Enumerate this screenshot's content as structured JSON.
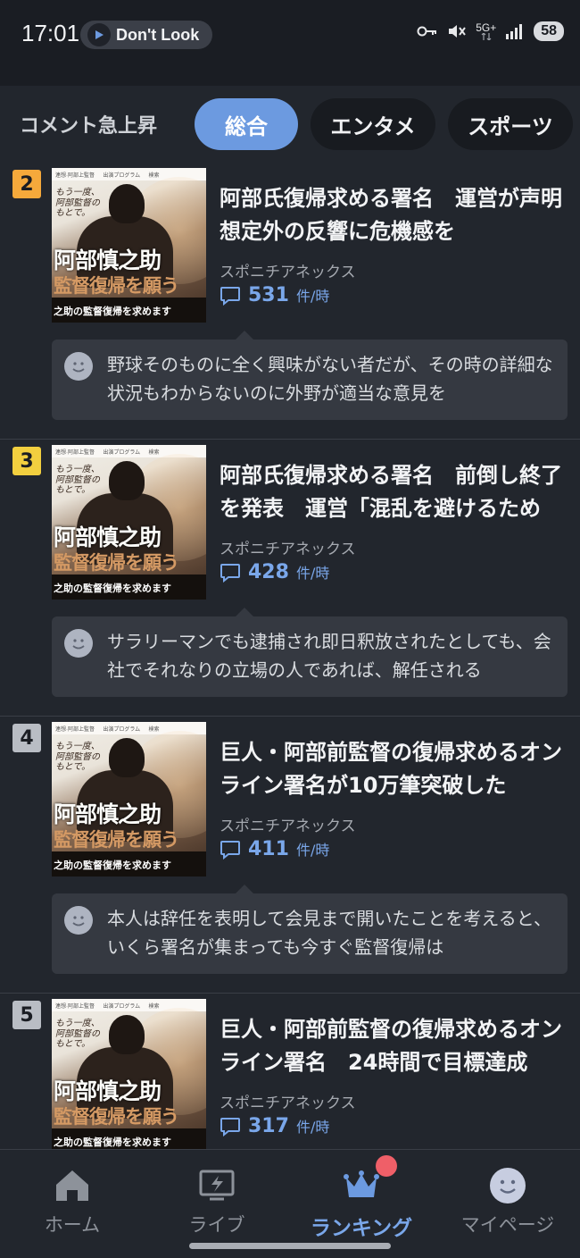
{
  "status_bar": {
    "time": "17:01",
    "notification": "Don't Look",
    "network": "5G+",
    "battery": "58",
    "icons": [
      "key-icon",
      "mute-icon",
      "signal-icon",
      "battery-icon"
    ]
  },
  "tabs_header": {
    "title": "コメント急上昇",
    "tabs": [
      {
        "label": "総合",
        "active": true
      },
      {
        "label": "エンタメ",
        "active": false
      },
      {
        "label": "スポーツ",
        "active": false
      }
    ]
  },
  "thumbnail_text": {
    "top_bar": "連想·阿部上監督 　 出演プログラム 　 検索",
    "pre": "もう一度、\n阿部監督の\nもとで。",
    "name": "阿部慎之助",
    "sub": "監督復帰を願う",
    "caption": "之助の監督復帰を求めます"
  },
  "articles": [
    {
      "rank": "2",
      "rank_color": "#f5a93b",
      "title": "阿部氏復帰求める署名　運営が声明　想定外の反響に危機感を",
      "source": "スポニチアネックス",
      "count": "531",
      "count_unit": "件/時",
      "comment": "野球そのものに全く興味がない者だが、その時の詳細な状況もわからないのに外野が適当な意見を"
    },
    {
      "rank": "3",
      "rank_color": "#f2cf3f",
      "title": "阿部氏復帰求める署名　前倒し終了を発表　運営「混乱を避けるため",
      "source": "スポニチアネックス",
      "count": "428",
      "count_unit": "件/時",
      "comment": "サラリーマンでも逮捕され即日釈放されたとしても、会社でそれなりの立場の人であれば、解任される"
    },
    {
      "rank": "4",
      "rank_color": "#b9bdc4",
      "title": "巨人・阿部前監督の復帰求めるオンライン署名が10万筆突破した",
      "source": "スポニチアネックス",
      "count": "411",
      "count_unit": "件/時",
      "comment": "本人は辞任を表明して会見まで開いたことを考えると、いくら署名が集まっても今すぐ監督復帰は"
    },
    {
      "rank": "5",
      "rank_color": "#b9bdc4",
      "title": "巨人・阿部前監督の復帰求めるオンライン署名　24時間で目標達成",
      "source": "スポニチアネックス",
      "count": "317",
      "count_unit": "件/時",
      "comment": ""
    }
  ],
  "bottom_nav": {
    "items": [
      {
        "label": "ホーム",
        "icon": "home-icon",
        "active": false
      },
      {
        "label": "ライブ",
        "icon": "live-icon",
        "active": false
      },
      {
        "label": "ランキング",
        "icon": "crown-icon",
        "active": true
      },
      {
        "label": "マイページ",
        "icon": "smiley-icon",
        "active": false
      }
    ]
  },
  "colors": {
    "accent": "#6c9ae0",
    "count": "#7aa7ea",
    "background": "#22262d"
  }
}
